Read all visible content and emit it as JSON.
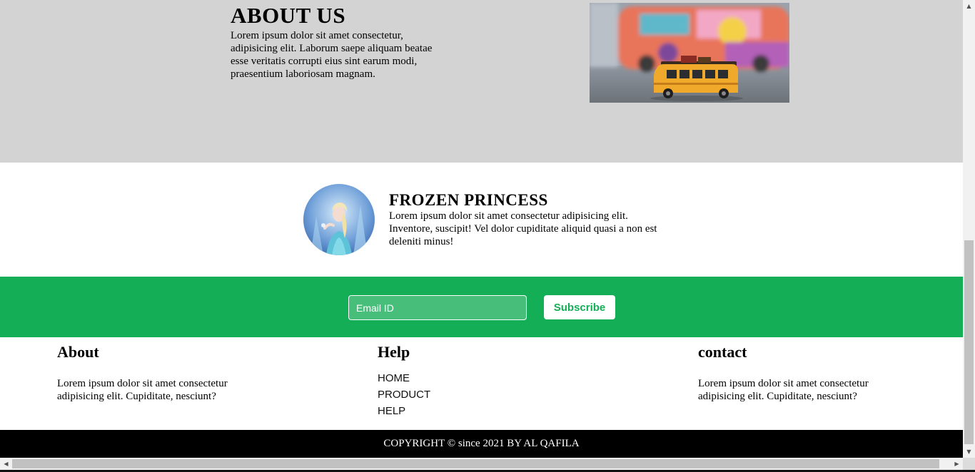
{
  "about": {
    "title": "ABOUT US",
    "text": "Lorem ipsum dolor sit amet consectetur, adipisicing elit. Laborum saepe aliquam beatae esse veritatis corrupti eius sint earum modi, praesentium laboriosam magnam."
  },
  "feature": {
    "title": "FROZEN PRINCESS",
    "text": "Lorem ipsum dolor sit amet consectetur adipisicing elit. Inventore, suscipit! Vel dolor cupiditate aliquid quasi a non est deleniti minus!"
  },
  "newsletter": {
    "email_placeholder": "Email ID",
    "subscribe_label": "Subscribe"
  },
  "footer": {
    "about": {
      "heading": "About",
      "text": "Lorem ipsum dolor sit amet consectetur adipisicing elit. Cupiditate, nesciunt?"
    },
    "help": {
      "heading": "Help",
      "links": [
        "HOME",
        "PRODUCT",
        "HELP"
      ]
    },
    "contact": {
      "heading": "contact",
      "text": "Lorem ipsum dolor sit amet consectetur adipisicing elit. Cupiditate, nesciunt?"
    },
    "copyright": "COPYRIGHT © since 2021 BY AL QAFILA"
  },
  "colors": {
    "section_gray": "#d3d3d3",
    "accent_green": "#14ae56",
    "footer_black": "#000000"
  },
  "icons": {
    "scroll_up": "triangle-up-icon",
    "scroll_down": "triangle-down-icon",
    "scroll_left": "triangle-left-icon",
    "scroll_right": "triangle-right-icon"
  }
}
